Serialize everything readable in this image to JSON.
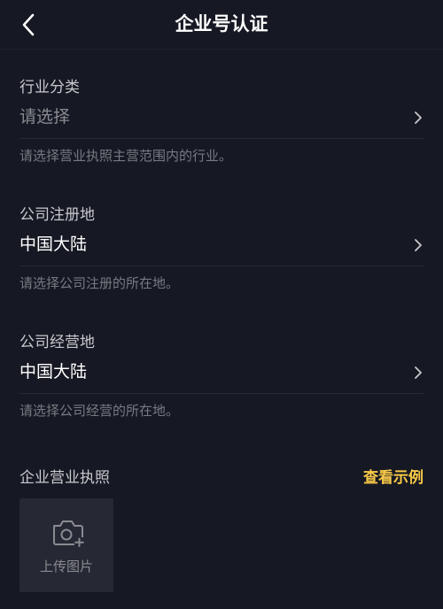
{
  "header": {
    "title": "企业号认证",
    "back_icon": "chevron-left-icon"
  },
  "industry": {
    "label": "行业分类",
    "value": "请选择",
    "hint": "请选择营业执照主营范围内的行业。"
  },
  "registration": {
    "label": "公司注册地",
    "value": "中国大陆",
    "hint": "请选择公司注册的所在地。"
  },
  "operation": {
    "label": "公司经营地",
    "value": "中国大陆",
    "hint": "请选择公司经营的所在地。"
  },
  "license": {
    "label": "企业营业执照",
    "example_link": "查看示例",
    "upload_label": "上传图片",
    "upload_icon": "camera-plus-icon"
  },
  "colors": {
    "background": "#161823",
    "accent": "#f8c847",
    "upload_box": "#262833"
  }
}
